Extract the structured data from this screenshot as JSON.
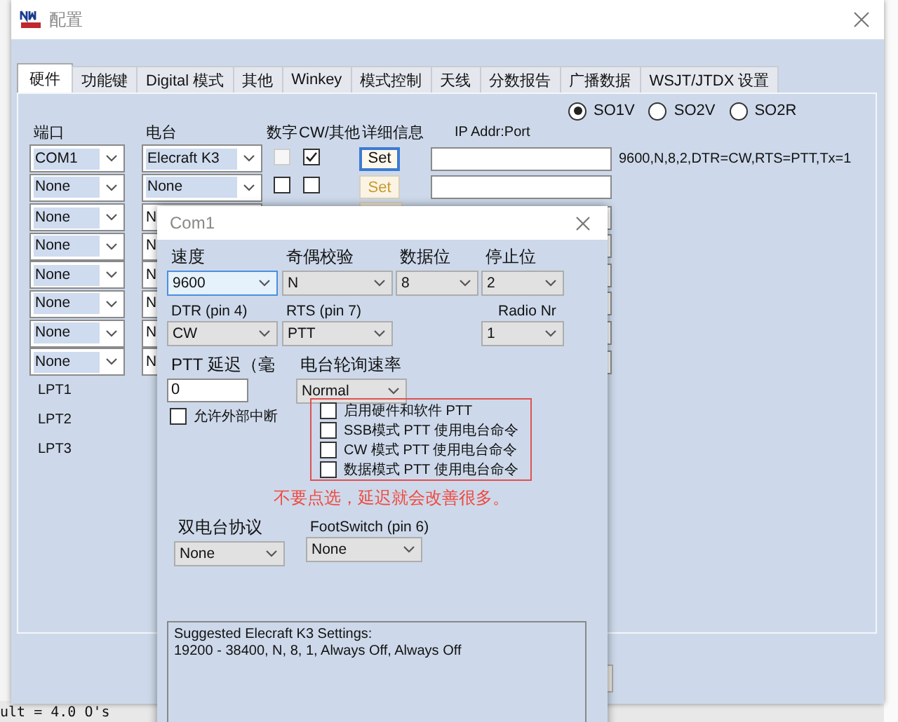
{
  "background": {
    "text": "ult = 4.0 O's"
  },
  "window": {
    "title": "配置"
  },
  "tabs": [
    {
      "label": "硬件",
      "selected": true
    },
    {
      "label": "功能键",
      "selected": false
    },
    {
      "label": "Digital 模式",
      "selected": false
    },
    {
      "label": "其他",
      "selected": false
    },
    {
      "label": "Winkey",
      "selected": false
    },
    {
      "label": "模式控制",
      "selected": false
    },
    {
      "label": "天线",
      "selected": false
    },
    {
      "label": "分数报告",
      "selected": false
    },
    {
      "label": "广播数据",
      "selected": false
    },
    {
      "label": "WSJT/JTDX 设置",
      "selected": false
    }
  ],
  "so_modes": [
    {
      "label": "SO1V",
      "selected": true
    },
    {
      "label": "SO2V",
      "selected": false
    },
    {
      "label": "SO2R",
      "selected": false
    }
  ],
  "columns": [
    "端口",
    "电台",
    "数字",
    "CW/其他",
    "详细信息",
    "IP Addr:Port"
  ],
  "ports": [
    {
      "kind": "full",
      "port": "COM1",
      "radio": "Elecraft K3",
      "digital": false,
      "digital_disabled": true,
      "cw": true,
      "set": "Set",
      "focused": true,
      "info": "9600,N,8,2,DTR=CW,RTS=PTT,Tx=1"
    },
    {
      "kind": "full",
      "port": "None",
      "radio": "None",
      "digital": false,
      "digital_disabled": false,
      "cw": false,
      "set": "Set",
      "focused": false
    },
    {
      "kind": "covered",
      "port": "None",
      "radio": "N"
    },
    {
      "kind": "covered",
      "port": "None",
      "radio": "N"
    },
    {
      "kind": "covered",
      "port": "None",
      "radio": "N"
    },
    {
      "kind": "covered",
      "port": "None",
      "radio": "N"
    },
    {
      "kind": "covered",
      "port": "None",
      "radio": "N"
    },
    {
      "kind": "covered",
      "port": "None",
      "radio": "N"
    }
  ],
  "lpt": [
    "LPT1",
    "LPT2",
    "LPT3"
  ],
  "dialog": {
    "title": "Com1",
    "row1": [
      {
        "label": "速度",
        "value": "9600",
        "focused": true
      },
      {
        "label": "奇偶校验",
        "value": "N",
        "focused": false
      },
      {
        "label": "数据位",
        "value": "8",
        "focused": false
      },
      {
        "label": "停止位",
        "value": "2",
        "focused": false
      }
    ],
    "row2": [
      {
        "label": "DTR (pin 4)",
        "value": "CW"
      },
      {
        "label": "RTS (pin 7)",
        "value": "PTT"
      },
      {
        "label": "Radio Nr",
        "value": "1"
      }
    ],
    "ptt_delay": {
      "label": "PTT 延迟（毫",
      "value": "0"
    },
    "poll_rate": {
      "label": "电台轮询速率",
      "value": "Normal"
    },
    "allow_interrupt": {
      "label": "允许外部中断",
      "checked": false
    },
    "ptt_options": [
      {
        "label": "启用硬件和软件 PTT",
        "checked": false
      },
      {
        "label": "SSB模式 PTT 使用电台命令",
        "checked": false
      },
      {
        "label": "CW 模式 PTT 使用电台命令",
        "checked": false
      },
      {
        "label": "数据模式 PTT 使用电台命令",
        "checked": false
      }
    ],
    "note": "不要点选，延迟就会改善很多。",
    "so2r": {
      "label": "双电台协议",
      "value": "None"
    },
    "footswitch": {
      "label": "FootSwitch (pin 6)",
      "value": "None"
    },
    "suggestions": [
      "Suggested Elecraft K3 Settings:",
      "19200 - 38400, N, 8, 1, Always Off, Always Off"
    ]
  }
}
